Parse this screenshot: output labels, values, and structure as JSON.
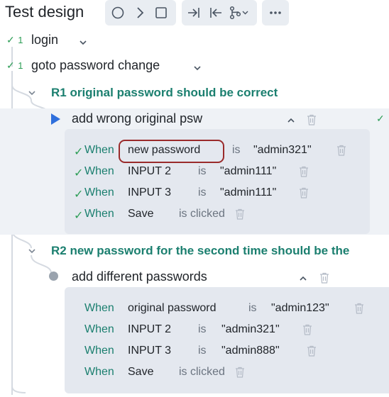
{
  "app": {
    "title": "Test design"
  },
  "toolbar": {
    "icons": [
      "circle-icon",
      "chevron-right-icon",
      "square-icon",
      "step-into-icon",
      "step-back-icon",
      "branch-icon",
      "more-icon"
    ]
  },
  "tree": {
    "nodes": [
      {
        "label": "login",
        "check": "✓",
        "count": "1"
      },
      {
        "label": "goto password change",
        "check": "✓",
        "count": "1"
      }
    ],
    "rules": [
      {
        "label": "R1 original password should be correct",
        "case": {
          "label": "add wrong original psw",
          "status": "✓"
        },
        "steps": [
          {
            "when": "When",
            "target": "new password",
            "op": "is",
            "value": "\"admin321\"",
            "check": "✓"
          },
          {
            "when": "When",
            "target": "INPUT 2",
            "op": "is",
            "value": "\"admin111\"",
            "check": "✓"
          },
          {
            "when": "When",
            "target": "INPUT 3",
            "op": "is",
            "value": "\"admin111\"",
            "check": "✓"
          },
          {
            "when": "When",
            "target": "Save",
            "op": "is clicked",
            "value": "",
            "check": "✓"
          }
        ]
      },
      {
        "label": "R2 new password for the second time should be the",
        "case": {
          "label": "add different passwords"
        },
        "steps": [
          {
            "when": "When",
            "target": "original password",
            "op": "is",
            "value": "\"admin123\""
          },
          {
            "when": "When",
            "target": "INPUT 2",
            "op": "is",
            "value": "\"admin321\""
          },
          {
            "when": "When",
            "target": "INPUT 3",
            "op": "is",
            "value": "\"admin888\""
          },
          {
            "when": "When",
            "target": "Save",
            "op": "is clicked",
            "value": ""
          }
        ]
      }
    ]
  },
  "colors": {
    "accent": "#1b7f6f",
    "pass": "#2e9e57",
    "highlight": "#9a2b2b",
    "run": "#2f6fdc"
  }
}
